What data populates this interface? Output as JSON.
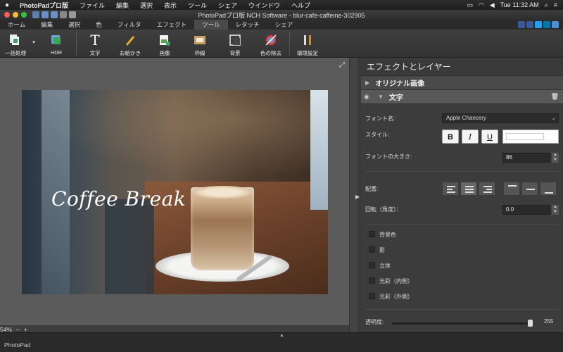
{
  "menubar": {
    "app": "PhotoPadプロ版",
    "items": [
      "ファイル",
      "編集",
      "選択",
      "表示",
      "ツール",
      "シェア",
      "ウインドウ",
      "ヘルプ"
    ],
    "clock": "Tue 11:32 AM"
  },
  "window": {
    "title": "PhotoPadプロ版 NCH Software - blur-cafe-caffeine-302905"
  },
  "tabs": [
    "ホーム",
    "編集",
    "選択",
    "色",
    "フィルタ",
    "エフェクト",
    "ツール",
    "レタッチ",
    "シェア"
  ],
  "active_tab": "ツール",
  "toolbar": {
    "batch": "一括処理",
    "hdr": "HDR",
    "text": "文字",
    "draw": "お絵かき",
    "image": "画像",
    "border": "枠線",
    "background": "背景",
    "remove_color": "色の除去",
    "settings": "環境設定"
  },
  "canvas": {
    "overlay_text": "Coffee Break"
  },
  "zoom": {
    "level": "54%",
    "minus": "−",
    "plus": "+"
  },
  "status": {
    "text": "PhotoPad"
  },
  "panel": {
    "title": "エフェクトとレイヤー",
    "layers": [
      {
        "name": "オリジナル画像"
      },
      {
        "name": "文字"
      }
    ],
    "font_label": "フォント名:",
    "font_value": "Apple Chancery",
    "style_label": "スタイル:",
    "bold": "B",
    "italic": "I",
    "underline": "U",
    "size_label": "フォントの大きさ:",
    "size_value": "86",
    "align_label": "配置:",
    "rotate_label": "回転（角度）：",
    "rotate_value": "0.0",
    "checks": [
      "背景色",
      "影",
      "立体",
      "光彩（内側）",
      "光彩（外側）"
    ],
    "opacity_label": "透明度:",
    "opacity_value": "255"
  },
  "colors": {
    "text_color": "#ffffff"
  }
}
